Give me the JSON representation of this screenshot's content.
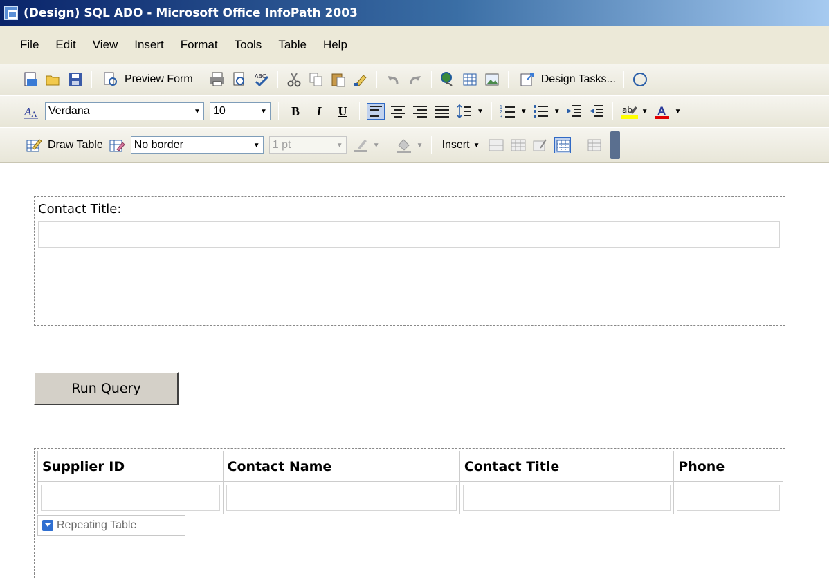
{
  "window": {
    "title": "(Design) SQL ADO - Microsoft Office InfoPath 2003"
  },
  "menu": [
    "File",
    "Edit",
    "View",
    "Insert",
    "Format",
    "Tools",
    "Table",
    "Help"
  ],
  "toolbar1": {
    "preview_label": "Preview Form",
    "design_tasks_label": "Design Tasks..."
  },
  "toolbar2": {
    "font": "Verdana",
    "size": "10",
    "bold": "B",
    "italic": "I",
    "underline": "U",
    "highlight_label": "ab",
    "font_color_label": "A",
    "highlight_color": "#ffff00",
    "font_color": "#e00000"
  },
  "toolbar3": {
    "draw_table_label": "Draw Table",
    "border_style": "No border",
    "border_width": "1 pt",
    "insert_label": "Insert"
  },
  "form": {
    "contact_title_label": "Contact Title:",
    "run_query_label": "Run Query",
    "table": {
      "columns": [
        "Supplier ID",
        "Contact Name",
        "Contact Title",
        "Phone"
      ]
    },
    "repeating_table_tag": "Repeating Table"
  }
}
